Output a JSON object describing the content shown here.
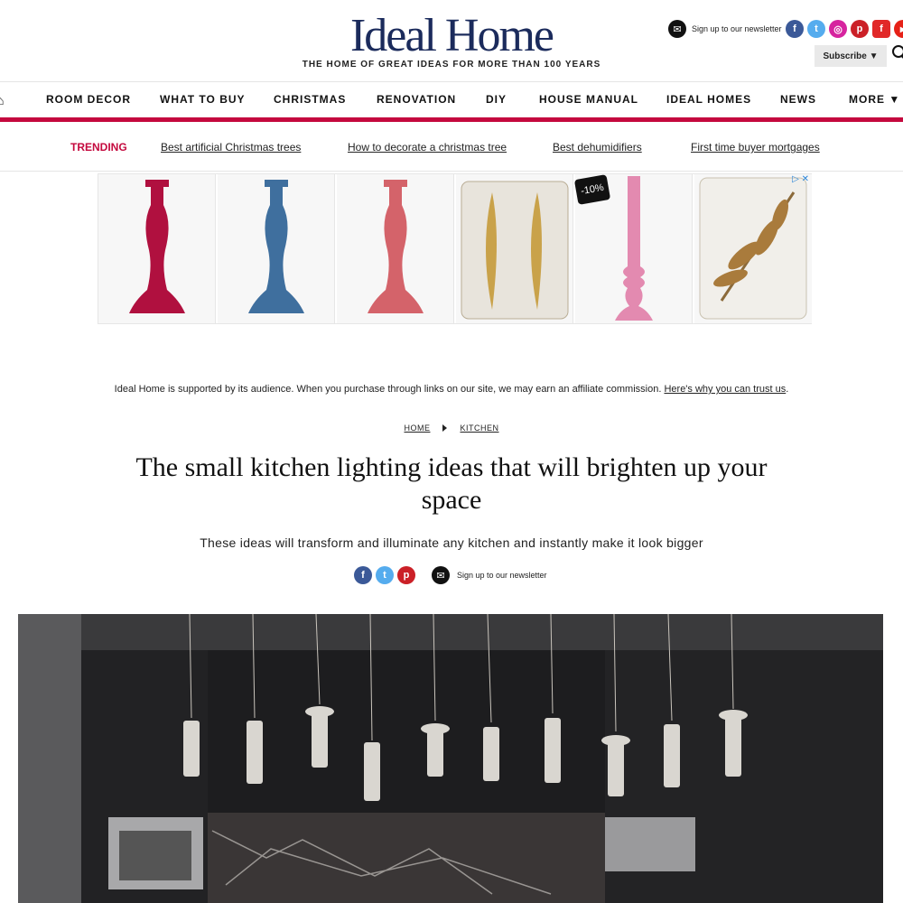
{
  "header": {
    "logo": "Ideal Home",
    "tagline": "THE HOME OF GREAT IDEAS FOR MORE THAN 100 YEARS",
    "newsletter_text": "Sign up to our newsletter",
    "subscribe_label": "Subscribe ▼",
    "social": [
      {
        "icon": "facebook-icon",
        "glyph": "f",
        "color": "#3b5998"
      },
      {
        "icon": "twitter-icon",
        "glyph": "t",
        "color": "#55acee"
      },
      {
        "icon": "instagram-icon",
        "glyph": "◎",
        "color": "#d6249f"
      },
      {
        "icon": "pinterest-icon",
        "glyph": "p",
        "color": "#cb2027"
      },
      {
        "icon": "flipboard-icon",
        "glyph": "f",
        "color": "#e12828"
      },
      {
        "icon": "youtube-icon",
        "glyph": "▶",
        "color": "#e62117"
      }
    ]
  },
  "nav": {
    "items": [
      "ROOM DECOR",
      "WHAT TO BUY",
      "CHRISTMAS",
      "RENOVATION",
      "DIY",
      "HOUSE MANUAL",
      "IDEAL HOMES",
      "NEWS",
      "MORE ▼"
    ]
  },
  "trending": {
    "label": "TRENDING",
    "links": [
      "Best artificial Christmas trees",
      "How to decorate a christmas tree",
      "Best dehumidifiers",
      "First time buyer mortgages"
    ]
  },
  "ad": {
    "discount": "-10%",
    "close": "▷ ✕",
    "colors": [
      "#b0103f",
      "#3f6f9e",
      "#d4636a",
      "#c9a24a",
      "#e38ab0",
      "#a97b3c"
    ]
  },
  "disclaimer": {
    "text": "Ideal Home is supported by its audience. When you purchase through links on our site, we may earn an affiliate commission.",
    "link": "Here's why you can trust us",
    "end": "."
  },
  "breadcrumb": {
    "home": "HOME",
    "section": "KITCHEN"
  },
  "article": {
    "title": "The small kitchen lighting ideas that will brighten up your space",
    "subtitle": "These ideas will transform and illuminate any kitchen and instantly make it look bigger",
    "newsletter_text": "Sign up to our newsletter"
  }
}
